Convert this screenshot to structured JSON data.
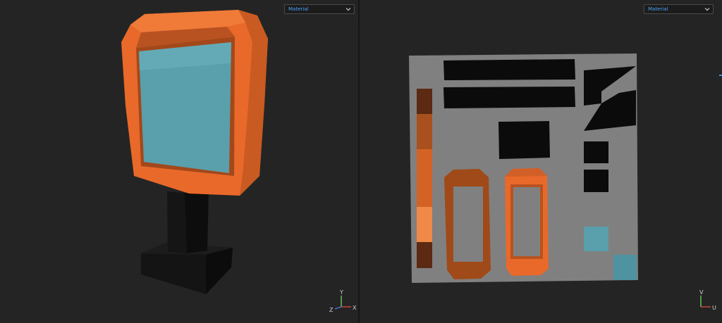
{
  "viewports": {
    "left": {
      "shading_mode": "Material",
      "gizmo": {
        "x": "X",
        "y": "Y",
        "z": "Z"
      }
    },
    "right": {
      "shading_mode": "Material",
      "gizmo": {
        "u": "U",
        "v": "V"
      }
    }
  },
  "colors": {
    "background": "#242424",
    "accent": "#4aa3ff",
    "frame_orange": "#e8692a",
    "screen_cyan": "#5aa0ac",
    "stand_black": "#121212",
    "uv_gray": "#808080"
  }
}
